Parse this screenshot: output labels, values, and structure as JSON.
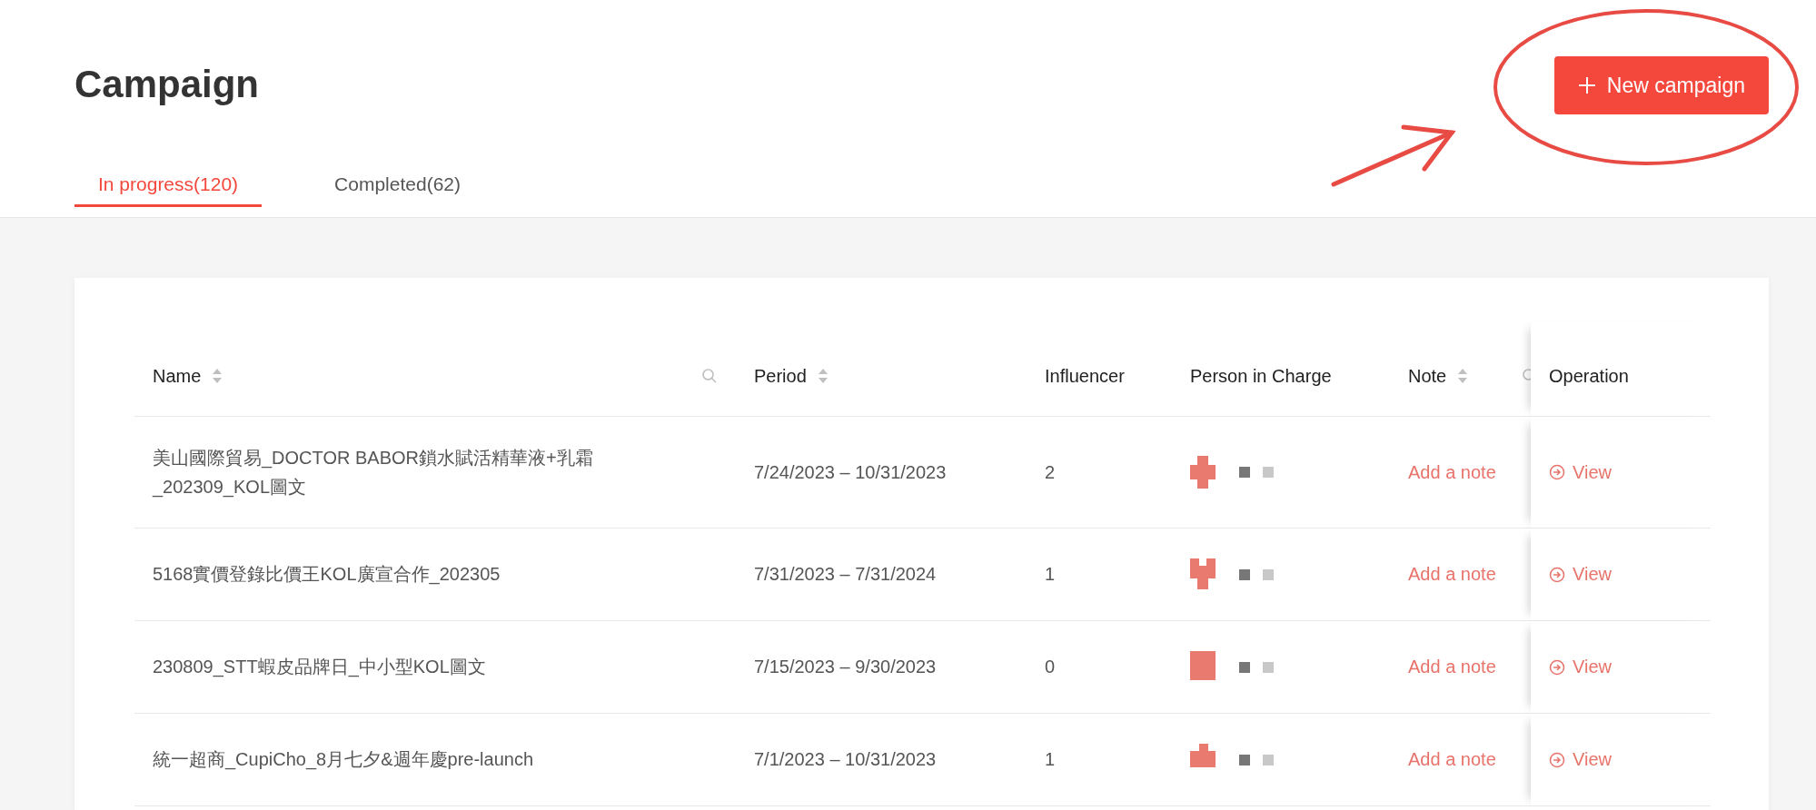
{
  "header": {
    "title": "Campaign",
    "new_button": {
      "label": "New campaign"
    }
  },
  "tabs": [
    {
      "label": "In progress(120)",
      "selected": true
    },
    {
      "label": "Completed(62)",
      "selected": false
    }
  ],
  "table": {
    "columns": [
      {
        "label": "Name",
        "sortable": true,
        "searchable": true
      },
      {
        "label": "Period",
        "sortable": true,
        "searchable": false
      },
      {
        "label": "Influencer",
        "sortable": false,
        "searchable": false
      },
      {
        "label": "Person in Charge",
        "sortable": false,
        "searchable": false
      },
      {
        "label": "Note",
        "sortable": true,
        "searchable": true
      },
      {
        "label": "Operation",
        "sortable": false,
        "searchable": false
      }
    ],
    "rows": [
      {
        "name": "美山國際貿易_DOCTOR BABOR鎖水賦活精華液+乳霜_202309_KOL圖文",
        "period": "7/24/2023 – 10/31/2023",
        "influencer": "2",
        "note": "Add a note",
        "action": "View"
      },
      {
        "name": "5168實價登錄比價王KOL廣宣合作_202305",
        "period": "7/31/2023 – 7/31/2024",
        "influencer": "1",
        "note": "Add a note",
        "action": "View"
      },
      {
        "name": "230809_STT蝦皮品牌日_中小型KOL圖文",
        "period": "7/15/2023 – 9/30/2023",
        "influencer": "0",
        "note": "Add a note",
        "action": "View"
      },
      {
        "name": "統一超商_CupiCho_8月七夕&週年慶pre-launch",
        "period": "7/1/2023 – 10/31/2023",
        "influencer": "1",
        "note": "Add a note",
        "action": "View"
      }
    ]
  }
}
